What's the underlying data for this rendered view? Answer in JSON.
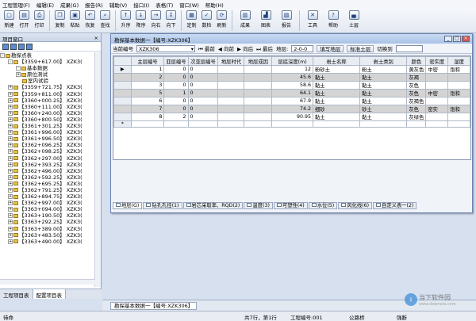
{
  "menu": [
    "工程管理(F)",
    "编辑(E)",
    "成果(G)",
    "报告(R)",
    "辅助(V)",
    "接口(I)",
    "表格(T)",
    "窗口(W)",
    "帮助(H)"
  ],
  "toolbar": [
    {
      "label": "新建",
      "icon": "new-icon",
      "glyph": "▢"
    },
    {
      "label": "打开",
      "icon": "open-icon",
      "glyph": "▤"
    },
    {
      "label": "打印",
      "icon": "print-icon",
      "glyph": "⎙"
    },
    {
      "label": "复制",
      "icon": "copy-icon",
      "glyph": "❐"
    },
    {
      "label": "粘贴",
      "icon": "paste-icon",
      "glyph": "▣"
    },
    {
      "label": "恢复",
      "icon": "undo-icon",
      "glyph": "↶"
    },
    {
      "label": "查找",
      "icon": "find-icon",
      "glyph": "⌕"
    },
    {
      "label": "升序",
      "icon": "sort-asc-icon",
      "glyph": "↑"
    },
    {
      "label": "降序",
      "icon": "sort-desc-icon",
      "glyph": "↓"
    },
    {
      "label": "向右",
      "icon": "right-icon",
      "glyph": "→"
    },
    {
      "label": "向下",
      "icon": "down-icon",
      "glyph": "↧"
    },
    {
      "label": "定制",
      "icon": "custom-icon",
      "glyph": "▦"
    },
    {
      "label": "数检",
      "icon": "check-icon",
      "glyph": "✓"
    },
    {
      "label": "刷新",
      "icon": "refresh-icon",
      "glyph": "⟳"
    },
    {
      "label": "成果",
      "icon": "result-icon",
      "glyph": "▥"
    },
    {
      "label": "图表",
      "icon": "chart-icon",
      "glyph": "▟"
    },
    {
      "label": "报告",
      "icon": "report-icon",
      "glyph": "▧"
    },
    {
      "label": "工具",
      "icon": "tools-icon",
      "glyph": "✕"
    },
    {
      "label": "帮助",
      "icon": "help-icon",
      "glyph": "?"
    },
    {
      "label": "土层",
      "icon": "soil-icon",
      "glyph": "▄"
    }
  ],
  "left_panel": {
    "title": "项目窗口",
    "close": "×",
    "root": "勘探点表",
    "tree": [
      {
        "text": "【3359+617.00】 XZK3(",
        "level": 1,
        "pm": "-"
      },
      {
        "text": "基本数据",
        "level": 2,
        "pm": "-"
      },
      {
        "text": "原位测试",
        "level": 2,
        "pm": "+"
      },
      {
        "text": "室内试验",
        "level": 2,
        "pm": ""
      },
      {
        "text": "【3359+721.75】 XZK3(",
        "level": 1,
        "pm": "+"
      },
      {
        "text": "【3359+811.00】 XZK3(",
        "level": 1,
        "pm": "+"
      },
      {
        "text": "【3360+000.25】 XZK3(",
        "level": 1,
        "pm": "+"
      },
      {
        "text": "【3360+111.00】 XZK3(",
        "level": 1,
        "pm": "+"
      },
      {
        "text": "【3360+240.00】 XZK3(",
        "level": 1,
        "pm": "+"
      },
      {
        "text": "【3360+800.50】 XZK3(",
        "level": 1,
        "pm": "+"
      },
      {
        "text": "【3361+301.25】 XZK3(",
        "level": 1,
        "pm": "+"
      },
      {
        "text": "【3361+996.00】 XZK3(",
        "level": 1,
        "pm": "+"
      },
      {
        "text": "【3361+996.50】 XZK3(",
        "level": 1,
        "pm": "+"
      },
      {
        "text": "【3362+096.25】 XZK3(",
        "level": 1,
        "pm": "+"
      },
      {
        "text": "【3362+098.25】 XZK3(",
        "level": 1,
        "pm": "+"
      },
      {
        "text": "【3362+297.00】 XZK3(",
        "level": 1,
        "pm": "+"
      },
      {
        "text": "【3362+393.25】 XZK3(",
        "level": 1,
        "pm": "+"
      },
      {
        "text": "【3362+496.00】 XZK3(",
        "level": 1,
        "pm": "+"
      },
      {
        "text": "【3362+592.25】 XZK3(",
        "level": 1,
        "pm": "+"
      },
      {
        "text": "【3362+695.25】 XZK3(",
        "level": 1,
        "pm": "+"
      },
      {
        "text": "【3362+791.25】 XZK3(",
        "level": 1,
        "pm": "+"
      },
      {
        "text": "【3362+894.75】 XZK3(",
        "level": 1,
        "pm": "+"
      },
      {
        "text": "【3362+997.00】 XZK3(",
        "level": 1,
        "pm": "+"
      },
      {
        "text": "【3363+094.00】 XZK3(",
        "level": 1,
        "pm": "+"
      },
      {
        "text": "【3363+190.50】 XZK3(",
        "level": 1,
        "pm": "+"
      },
      {
        "text": "【3363+292.25】 XZK3(",
        "level": 1,
        "pm": "+"
      },
      {
        "text": "【3363+389.00】 XZK3(",
        "level": 1,
        "pm": "+"
      },
      {
        "text": "【3363+483.50】 XZK3(",
        "level": 1,
        "pm": "+"
      },
      {
        "text": "【3363+490.00】 XZK3(",
        "level": 1,
        "pm": "+"
      }
    ],
    "tabs": [
      "工程项目表",
      "配置项目表"
    ]
  },
  "window": {
    "title": "勘探基本数据一【编号:XZK306】",
    "current_label": "当前编号",
    "current_value": "XZK306",
    "nav": [
      "最前",
      "向前",
      "向后",
      "最后"
    ],
    "layer_label": "地层:",
    "layer_value": "2-0-0",
    "btn_fill": "填写地层",
    "btn_std": "标准土层",
    "switch_label": "切换到",
    "columns": [
      "主层编号",
      "亚层编号",
      "次亚层编号",
      "地层时代",
      "地层成因",
      "层底深度(m)",
      "岩土名称",
      "岩土类别",
      "颜色",
      "密实度",
      "湿度"
    ],
    "rows": [
      [
        "1",
        "0",
        "0",
        "",
        "",
        "12",
        "粉砂土",
        "粉土",
        "黄灰色",
        "中密",
        "饱和"
      ],
      [
        "2",
        "0",
        "0",
        "",
        "",
        "45.6",
        "黏土",
        "黏土",
        "灰褐",
        "",
        ""
      ],
      [
        "3",
        "0",
        "0",
        "",
        "",
        "58.6",
        "黏土",
        "黏土",
        "灰色",
        "",
        ""
      ],
      [
        "5",
        "1",
        "0",
        "",
        "",
        "64.1",
        "黏土",
        "黏土",
        "灰色",
        "中密",
        "饱和"
      ],
      [
        "6",
        "0",
        "0",
        "",
        "",
        "67.9",
        "黏土",
        "黏土",
        "灰褐色",
        "",
        ""
      ],
      [
        "7",
        "0",
        "0",
        "",
        "",
        "74.2",
        "细砂",
        "砂土",
        "灰色",
        "密实",
        "饱和"
      ],
      [
        "8",
        "2",
        "0",
        "",
        "",
        "90.95",
        "黏土",
        "黏土",
        "灰绿色",
        "",
        ""
      ]
    ],
    "tabs": [
      "地层(G)",
      "钻孔孔径(1)",
      "岩芯采取率、RQD(2)",
      "温度(3)",
      "可塑性(4)",
      "水位(5)",
      "风化线(6)",
      "自定义表一(2)"
    ],
    "row_marker": "▶",
    "new_marker": "*"
  },
  "taskbar": {
    "item": "勘探基本数据一【编号:XZK306】"
  },
  "status": {
    "ready": "待命",
    "rows": "共7行，第1行",
    "code": "工程编号:001",
    "field": "公路桥",
    "extra": "强断"
  },
  "watermark": {
    "line1": "当下软件园",
    "line2": "www.downxia.com"
  }
}
